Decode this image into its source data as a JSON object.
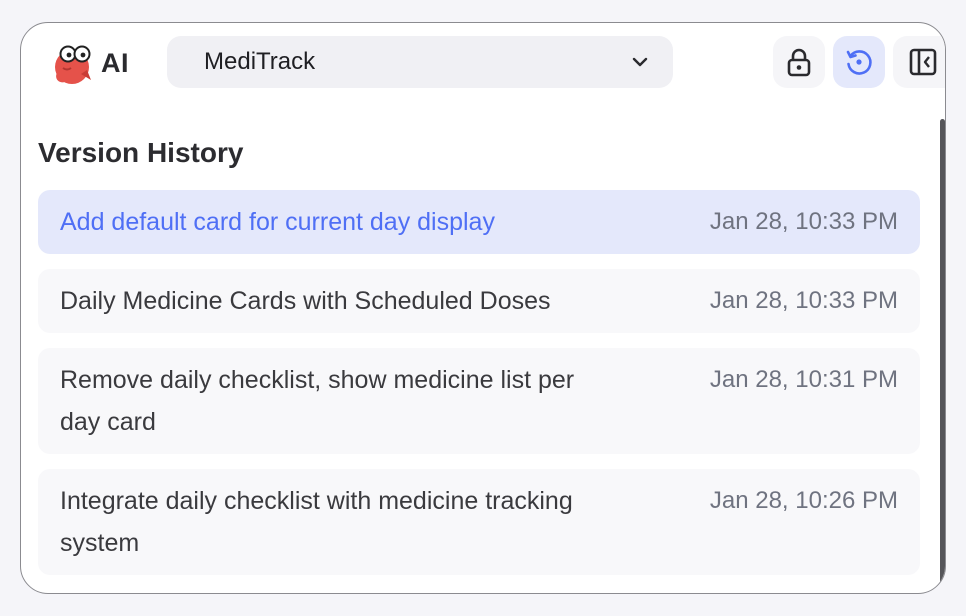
{
  "header": {
    "ai_label": "AI",
    "project": {
      "selected": "MediTrack",
      "chevron_icon": "chevron-down-icon"
    },
    "buttons": [
      {
        "name": "lock",
        "icon": "lock-icon",
        "active": false
      },
      {
        "name": "history",
        "icon": "history-icon",
        "active": true
      },
      {
        "name": "sidebar",
        "icon": "sidebar-toggle-icon",
        "active": false
      }
    ]
  },
  "version_history": {
    "title": "Version History",
    "items": [
      {
        "message": "Add default card for current day display",
        "time": "Jan 28, 10:33 PM",
        "selected": true
      },
      {
        "message": "Daily Medicine Cards with Scheduled Doses",
        "time": "Jan 28, 10:33 PM",
        "selected": false
      },
      {
        "message": "Remove daily checklist, show medicine list per day card",
        "time": "Jan 28, 10:31 PM",
        "selected": false
      },
      {
        "message": "Integrate daily checklist with medicine tracking system",
        "time": "Jan 28, 10:26 PM",
        "selected": false
      }
    ]
  },
  "colors": {
    "accent": "#4f6ff5",
    "selected_bg": "#e4e8fb",
    "item_bg": "#f8f8fa",
    "mascot": "#e5524a"
  }
}
